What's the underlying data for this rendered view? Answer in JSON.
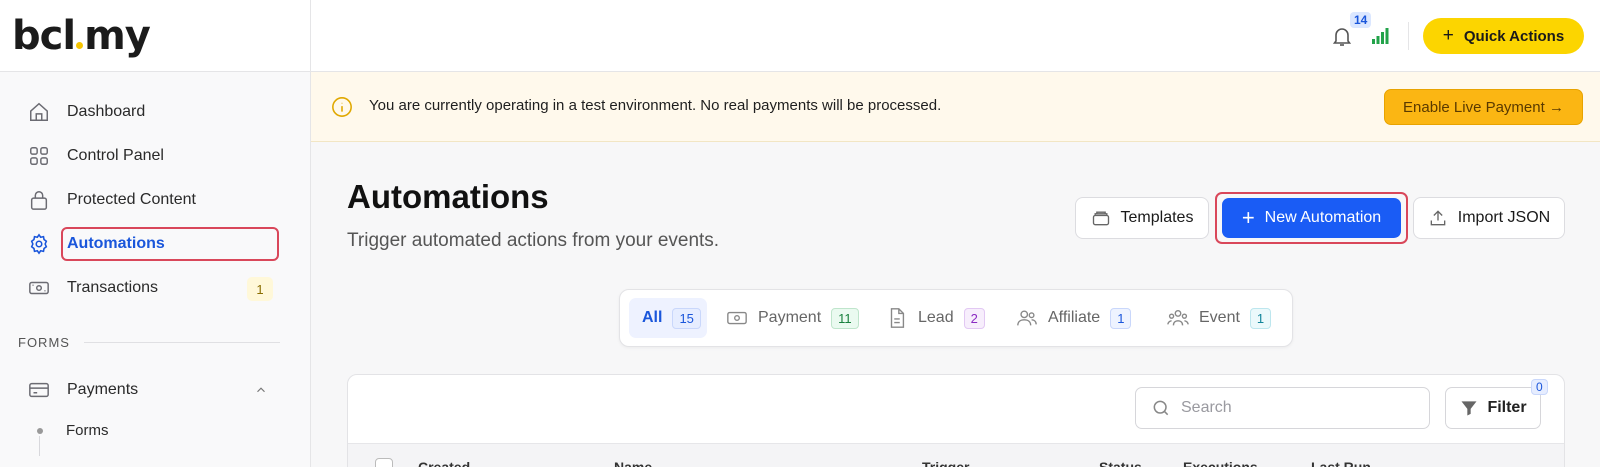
{
  "brand": {
    "logo_left": "bcl",
    "logo_right": "my"
  },
  "sidebar": {
    "items": [
      {
        "label": "Dashboard"
      },
      {
        "label": "Control Panel"
      },
      {
        "label": "Protected Content"
      },
      {
        "label": "Automations"
      },
      {
        "label": "Transactions",
        "count": "1"
      }
    ],
    "section": "FORMS",
    "payments": {
      "label": "Payments",
      "sub": [
        {
          "label": "Forms"
        }
      ]
    }
  },
  "header": {
    "notification_count": "14",
    "quick_actions": "Quick Actions"
  },
  "banner": {
    "message": "You are currently operating in a test environment. No real payments will be processed.",
    "button": "Enable Live Payment →"
  },
  "page": {
    "title": "Automations",
    "subtitle": "Trigger automated actions from your events.",
    "templates": "Templates",
    "new_automation": "New Automation",
    "import_json": "Import JSON"
  },
  "tabs": [
    {
      "label": "All",
      "count": "15"
    },
    {
      "label": "Payment",
      "count": "11"
    },
    {
      "label": "Lead",
      "count": "2"
    },
    {
      "label": "Affiliate",
      "count": "1"
    },
    {
      "label": "Event",
      "count": "1"
    }
  ],
  "table": {
    "search_placeholder": "Search",
    "filter": "Filter",
    "filter_count": "0",
    "columns": [
      "Created",
      "Name",
      "Trigger",
      "Status",
      "Executions",
      "Last Run"
    ]
  },
  "colors": {
    "accent": "#1a5cf5",
    "brand_yellow": "#fcd500",
    "warning": "#fbb613",
    "highlight": "#d9475a"
  }
}
